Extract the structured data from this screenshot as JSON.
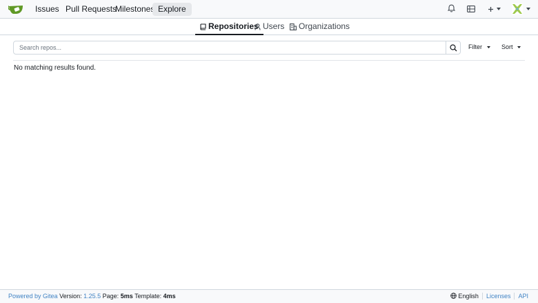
{
  "navbar": {
    "items": [
      {
        "label": "Issues",
        "active": false
      },
      {
        "label": "Pull Requests",
        "active": false
      },
      {
        "label": "Milestones",
        "active": false
      },
      {
        "label": "Explore",
        "active": true
      }
    ],
    "icons": [
      "gitea-logo",
      "bell-icon",
      "server-icon",
      "plus-icon",
      "avatar",
      "chevron-down-icon"
    ]
  },
  "tabs": [
    {
      "label": "Repositories",
      "icon": "repo-icon",
      "active": true
    },
    {
      "label": "Users",
      "icon": "person-icon",
      "active": false
    },
    {
      "label": "Organizations",
      "icon": "organization-icon",
      "active": false
    }
  ],
  "search": {
    "placeholder": "Search repos...",
    "value": ""
  },
  "filters": {
    "filter_label": "Filter",
    "sort_label": "Sort"
  },
  "results": {
    "empty_message": "No matching results found."
  },
  "footer": {
    "powered_by": "Powered by Gitea",
    "version_label": "Version:",
    "version": "1.25.5",
    "page_label": "Page:",
    "page_time": "5ms",
    "template_label": "Template:",
    "template_time": "4ms",
    "language": "English",
    "licenses": "Licenses",
    "api": "API"
  },
  "colors": {
    "link": "#4183c4",
    "brand": "#609926",
    "text": "#181c21"
  }
}
